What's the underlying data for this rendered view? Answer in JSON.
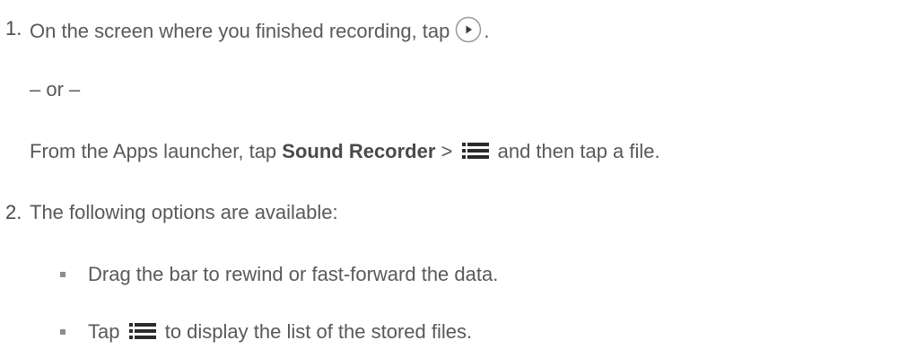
{
  "steps": [
    {
      "number": "1.",
      "text_before": "On the screen where you finished recording, tap",
      "icon": "play-icon",
      "text_after": ".",
      "or": "– or –",
      "alt_prefix": "From the Apps launcher, tap ",
      "alt_bold": "Sound Recorder",
      "alt_middle": " > ",
      "alt_icon": "list-icon",
      "alt_suffix": " and then tap a file."
    },
    {
      "number": "2.",
      "text": "The following options are available:",
      "bullets": [
        {
          "text": "Drag the bar to rewind or fast-forward the data."
        },
        {
          "prefix": "Tap ",
          "icon": "list-icon",
          "suffix": " to display the list of the stored files."
        }
      ]
    }
  ]
}
